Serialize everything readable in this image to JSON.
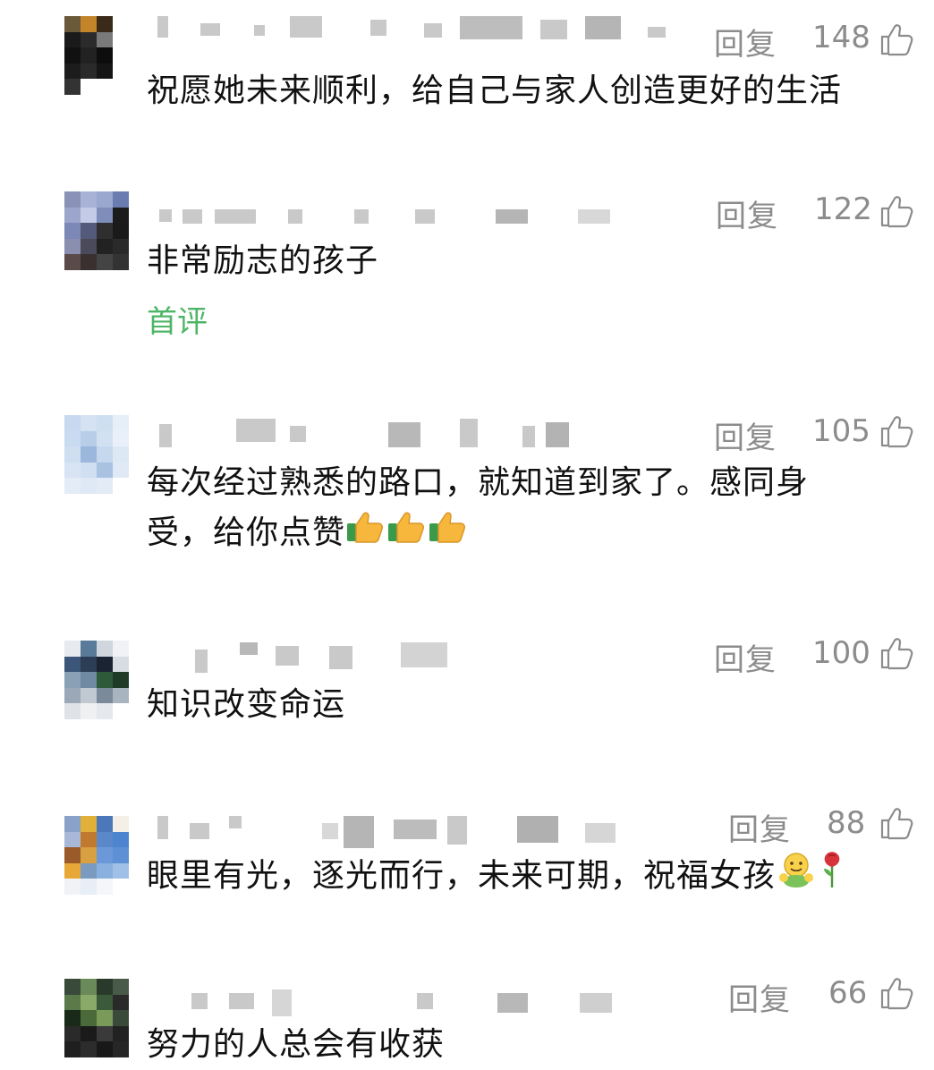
{
  "comments": [
    {
      "likes": "148",
      "reply_label": "回复",
      "text": "祝愿她未来顺利，给自己与家人创造更好的生活"
    },
    {
      "likes": "122",
      "reply_label": "回复",
      "text": "非常励志的孩子",
      "badge": "首评"
    },
    {
      "likes": "105",
      "reply_label": "回复",
      "text_line1": "每次经过熟悉的路口，就知道到家了。感同身",
      "text_line2": "受，给你点赞"
    },
    {
      "likes": "100",
      "reply_label": "回复",
      "text": "知识改变命运"
    },
    {
      "likes": "88",
      "reply_label": "回复",
      "text": "眼里有光，逐光而行，未来可期，祝福女孩"
    },
    {
      "likes": "66",
      "reply_label": "回复",
      "text": "努力的人总会有收获"
    }
  ],
  "colors": {
    "meta": "#8c8c8c",
    "text": "#111111",
    "badge": "#4fb566",
    "blur": "#c9c9c9"
  },
  "icons": {
    "like": "thumbs-up-outline-icon",
    "emoji_thumbs": "thumbs-up-emoji",
    "emoji_hug": "hugging-emoji",
    "emoji_rose": "rose-emoji"
  }
}
